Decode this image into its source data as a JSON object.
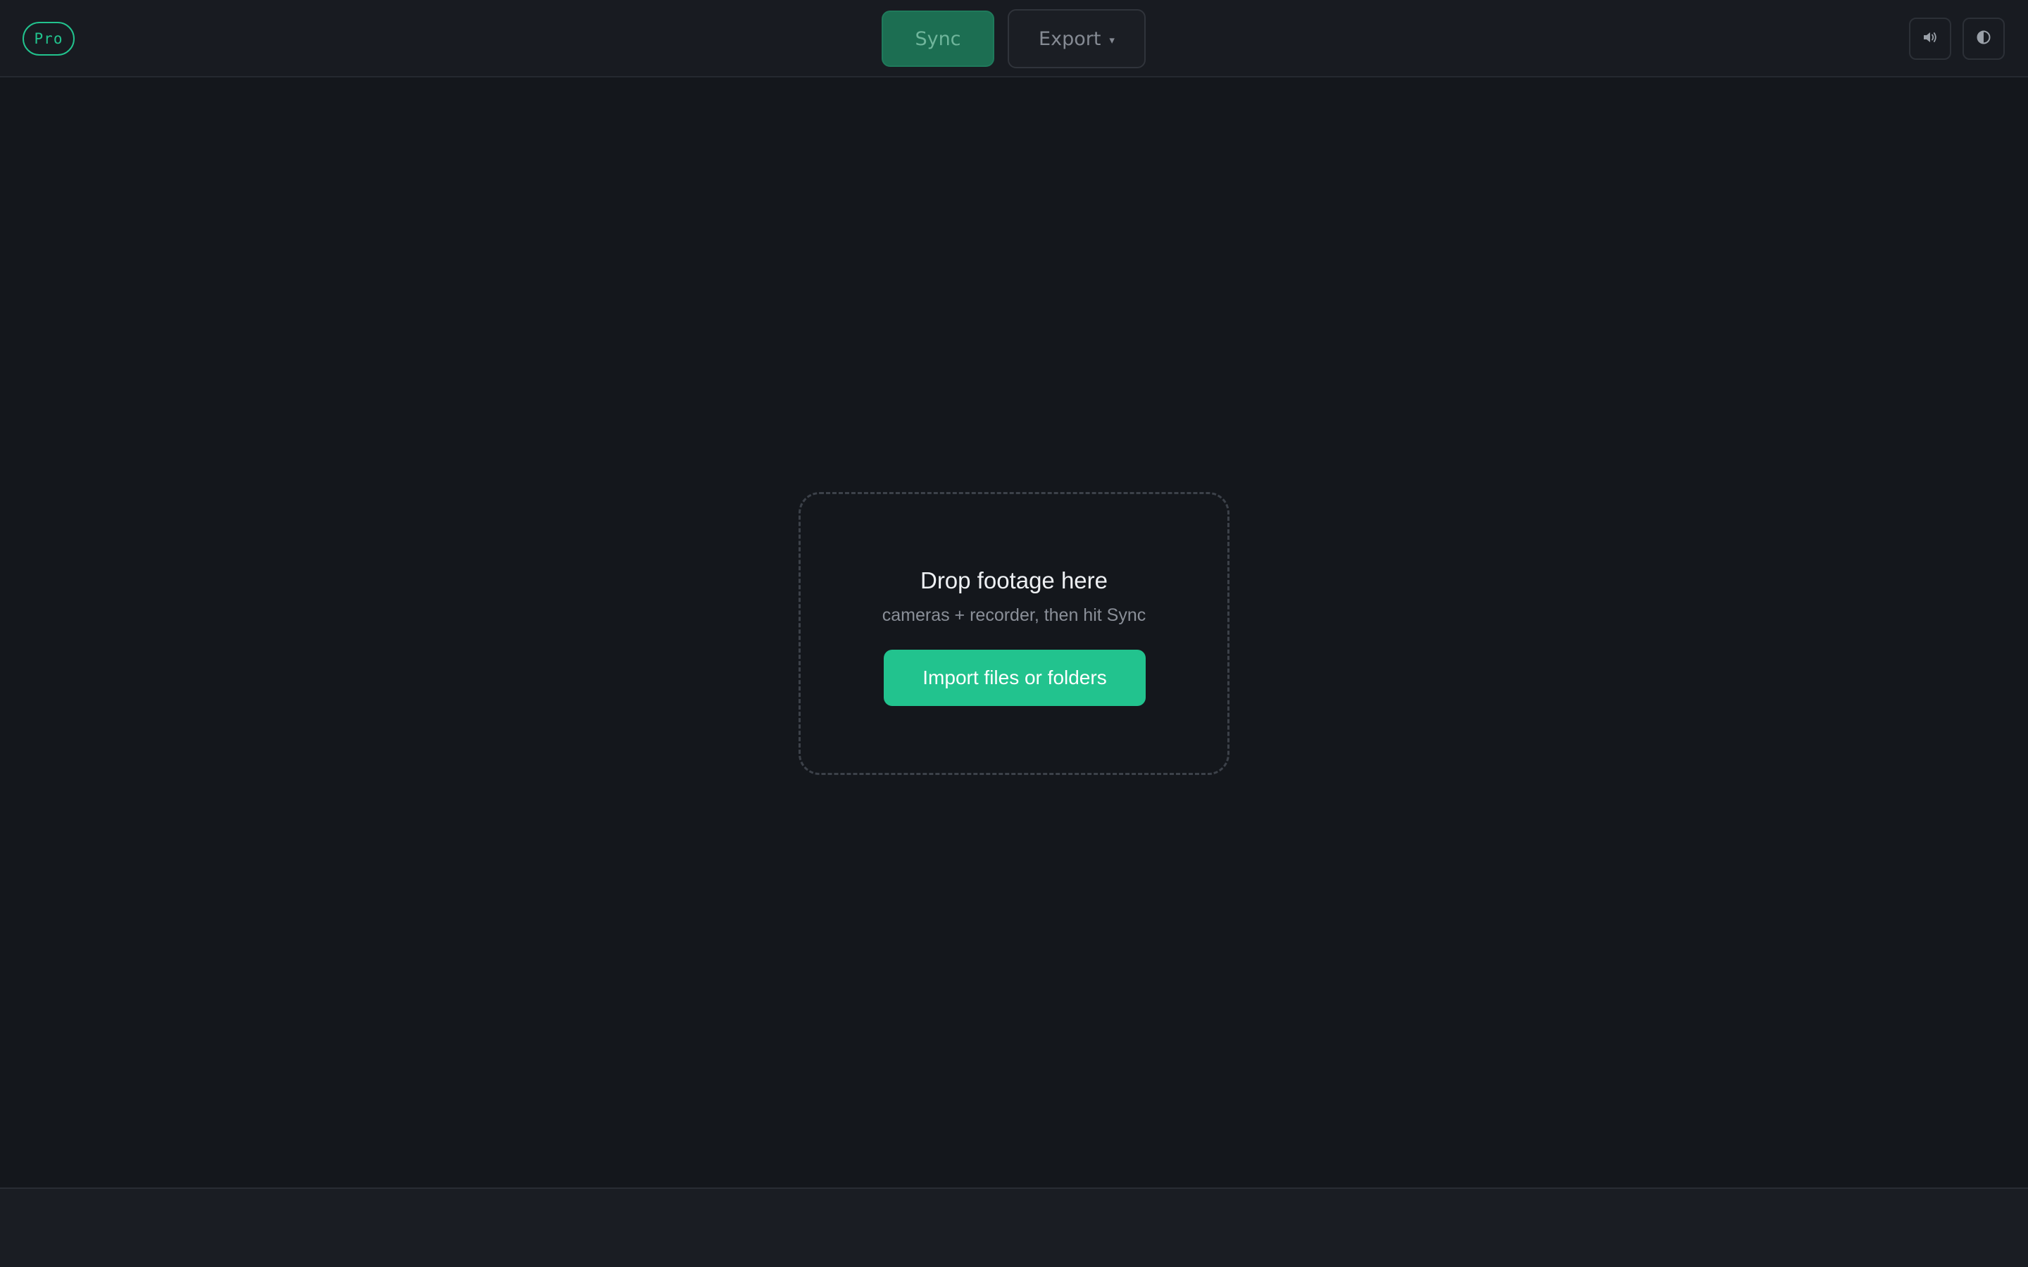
{
  "header": {
    "badge": "Pro",
    "sync_label": "Sync",
    "export_label": "Export",
    "export_caret": "▾",
    "icons": {
      "sound": "speaker-icon",
      "theme": "half-circle-contrast-icon"
    }
  },
  "dropzone": {
    "title": "Drop footage here",
    "subtitle": "cameras + recorder, then hit Sync",
    "import_label": "Import files or folders"
  },
  "colors": {
    "accent": "#22c38e",
    "sync_disabled_bg": "#1c6e52",
    "background": "#14171c",
    "topbar": "#181b21"
  }
}
